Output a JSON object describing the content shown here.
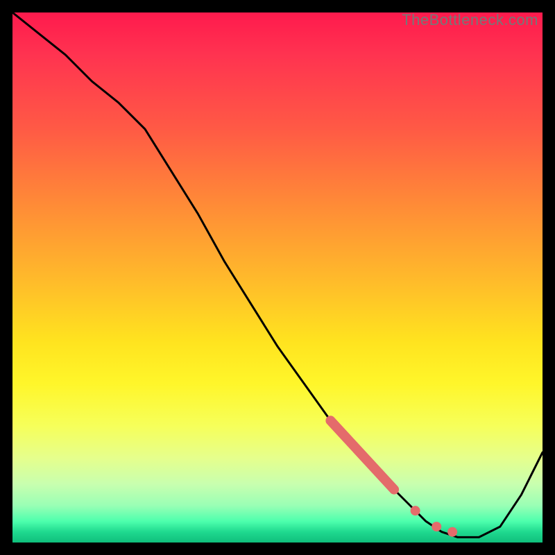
{
  "watermark": "TheBottleneck.com",
  "chart_data": {
    "type": "line",
    "title": "",
    "xlabel": "",
    "ylabel": "",
    "xlim": [
      0,
      100
    ],
    "ylim": [
      0,
      100
    ],
    "grid": false,
    "legend": false,
    "series": [
      {
        "name": "curve",
        "x": [
          0,
          5,
          10,
          15,
          20,
          25,
          30,
          35,
          40,
          45,
          50,
          55,
          60,
          65,
          70,
          75,
          78,
          81,
          84,
          88,
          92,
          96,
          100
        ],
        "values": [
          100,
          96,
          92,
          87,
          83,
          78,
          70,
          62,
          53,
          45,
          37,
          30,
          23,
          17,
          12,
          7,
          4,
          2,
          1,
          1,
          3,
          9,
          17
        ]
      }
    ],
    "markers": [
      {
        "name": "zone-start",
        "x": 60,
        "y": 23
      },
      {
        "name": "zone-end",
        "x": 72,
        "y": 10
      },
      {
        "name": "dot1",
        "x": 76,
        "y": 6
      },
      {
        "name": "dot2",
        "x": 80,
        "y": 3
      },
      {
        "name": "dot3",
        "x": 83,
        "y": 2
      }
    ],
    "colors": {
      "curve": "#000000",
      "marker": "#e46b6b"
    }
  }
}
